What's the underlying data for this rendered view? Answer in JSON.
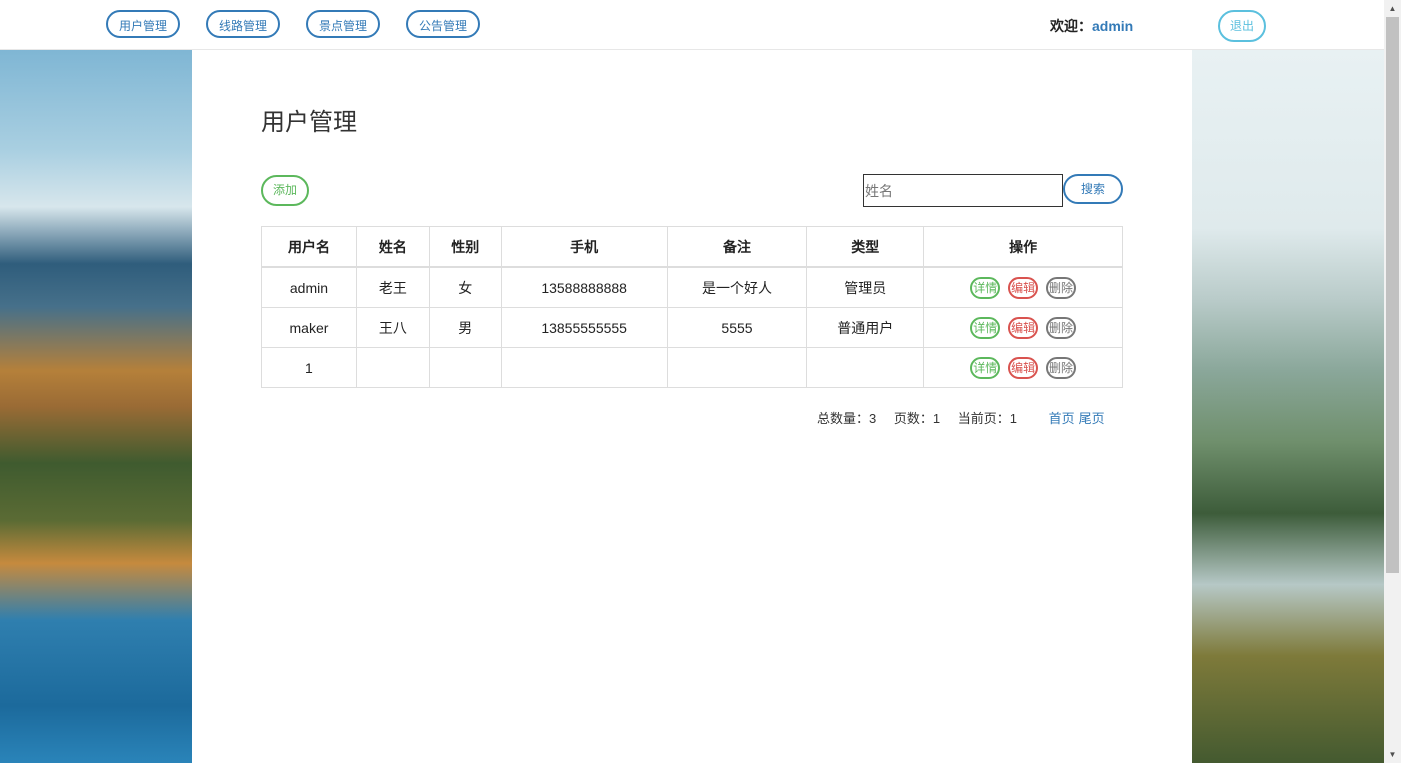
{
  "nav": {
    "items": [
      "用户管理",
      "线路管理",
      "景点管理",
      "公告管理"
    ],
    "welcome_label": "欢迎：",
    "username": "admin",
    "logout_label": "退出"
  },
  "main": {
    "title": "用户管理",
    "add_label": "添加",
    "search": {
      "placeholder": "姓名",
      "button_label": "搜索"
    },
    "table": {
      "headers": [
        "用户名",
        "姓名",
        "性别",
        "手机",
        "备注",
        "类型",
        "操作"
      ],
      "rows": [
        [
          "admin",
          "老王",
          "女",
          "13588888888",
          "是一个好人",
          "管理员"
        ],
        [
          "maker",
          "王八",
          "男",
          "13855555555",
          "5555",
          "普通用户"
        ],
        [
          "1",
          "",
          "",
          "",
          "",
          ""
        ]
      ],
      "actions": {
        "detail": "详情",
        "edit": "编辑",
        "delete": "删除"
      }
    },
    "pager": {
      "total": "总数量：3",
      "pages": "页数：1",
      "current": "当前页：1",
      "first": "首页",
      "last": "尾页"
    }
  },
  "colors": {
    "primary": "#337ab7",
    "success": "#5cb85c",
    "danger": "#d9534f",
    "info": "#5bc0de"
  }
}
